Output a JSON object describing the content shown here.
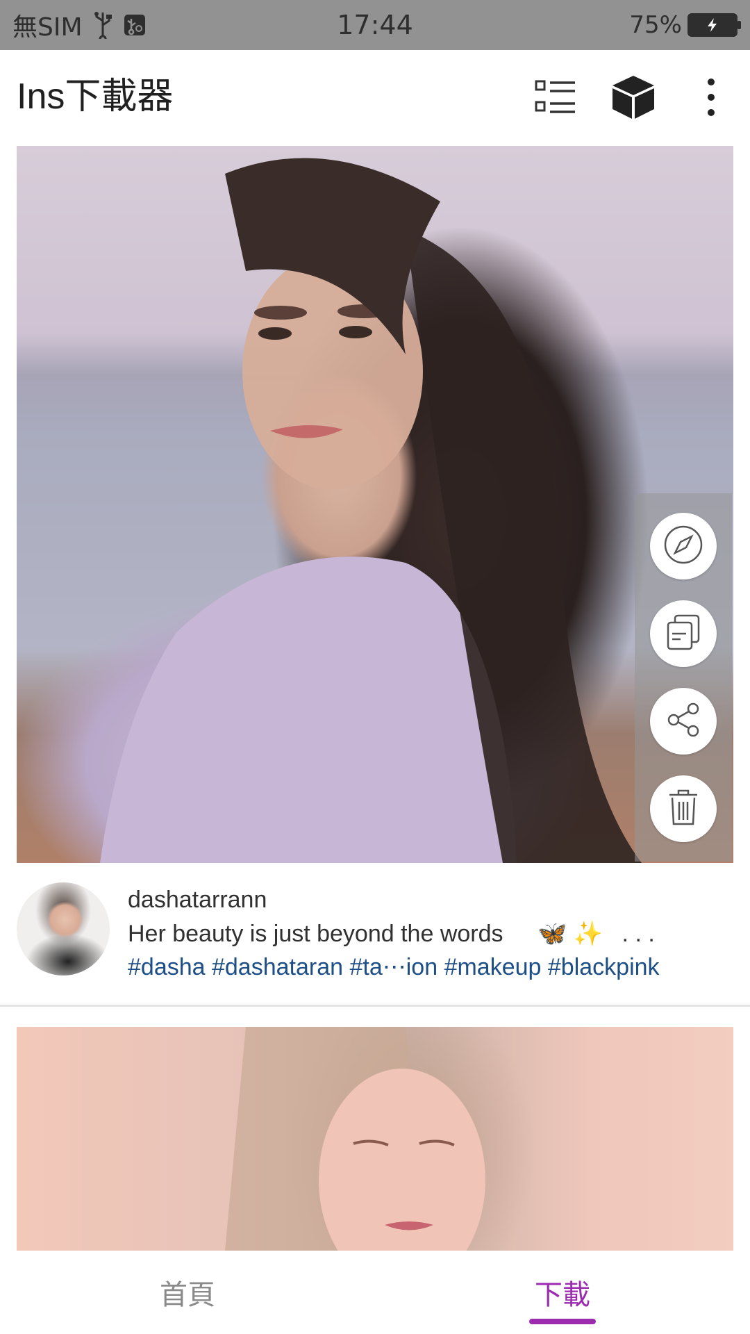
{
  "status_bar": {
    "carrier": "無SIM",
    "time": "17:44",
    "battery_percent": "75%"
  },
  "app_bar": {
    "title": "Ins下載器",
    "icons": [
      "list-view-icon",
      "cube-icon",
      "more-vert-icon"
    ]
  },
  "post": {
    "username": "dashatarrann",
    "caption": "Her beauty is just beyond the words",
    "caption_emoji": "🦋 ✨",
    "caption_more": ". . .",
    "hashtags": "#dasha #dashataran #ta⋯ion #makeup #blackpink",
    "actions": [
      "compass-icon",
      "copy-icon",
      "share-icon",
      "delete-icon"
    ]
  },
  "bottom_nav": {
    "home_label": "首頁",
    "download_label": "下載",
    "active": "download"
  },
  "colors": {
    "accent": "#9c2bb0",
    "hashtag": "#1d4f86",
    "status_bar_bg": "#929292"
  }
}
